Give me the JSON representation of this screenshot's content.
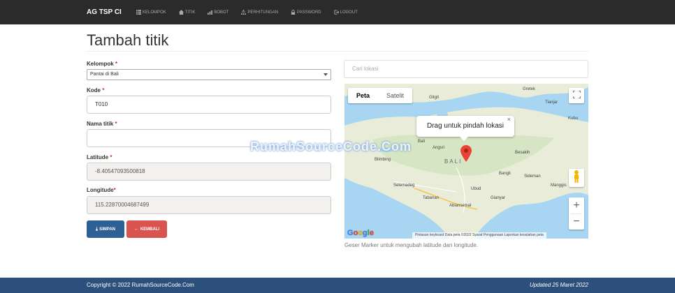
{
  "navbar": {
    "brand": "AG TSP CI",
    "items": [
      {
        "label": "KELOMPOK",
        "icon": "list-icon"
      },
      {
        "label": "TITIK",
        "icon": "home-icon"
      },
      {
        "label": "BOBOT",
        "icon": "bar-chart-icon"
      },
      {
        "label": "PERHITUNGAN",
        "icon": "sitemap-icon"
      },
      {
        "label": "PASSWORD",
        "icon": "lock-icon"
      },
      {
        "label": "LOGOUT",
        "icon": "logout-icon"
      }
    ]
  },
  "page": {
    "title": "Tambah titik"
  },
  "form": {
    "kelompok_label": "Kelompok",
    "kelompok_value": "Pantai di Bali",
    "kode_label": "Kode",
    "kode_value": "T010",
    "nama_label": "Nama titik",
    "nama_value": "",
    "lat_label": "Latitude",
    "lat_value": "-8.40547093500818",
    "lng_label": "Longitude",
    "lng_value": "115.22870004687499",
    "required_mark": "*",
    "save_label": "SIMPAN",
    "back_label": "KEMBALI"
  },
  "map": {
    "search_placeholder": "Cari lokasi",
    "type_map": "Peta",
    "type_satellite": "Satelit",
    "info_text": "Drag untuk pindah lokasi",
    "info_close": "×",
    "zoom_in": "+",
    "zoom_out": "−",
    "places": {
      "gitgit": "Gitgit",
      "gretek": "Gretek",
      "tianjar": "Tianjar",
      "kubu": "Kubu",
      "bali_small": "Bali",
      "angsri": "Angsri",
      "bali": "BALI",
      "besakih": "Besakih",
      "blimbing": "Blimbing",
      "bangli": "Bangli",
      "sideman": "Sideman",
      "selemadeg": "Selemadeg",
      "ubud": "Ubud",
      "manggis": "Manggis",
      "tabanan": "Tabanan",
      "gianyar": "Gianyar",
      "abiansemal": "Abiansemal"
    },
    "attribution": "Pintasan keyboard   Data peta ©2022   Syarat Penggunaan   Laporkan kesalahan peta",
    "help_text": "Geser Marker untuk mengubah latitude dan longitude."
  },
  "watermark": "RumahSourceCode.Com",
  "footer": {
    "copyright": "Copyright © 2022 RumahSourceCode.Com",
    "updated": "Updated 25 Maret 2022"
  },
  "colors": {
    "navbar": "#2b2b2b",
    "footer": "#2c4f7c",
    "save": "#2e6096",
    "back": "#d9534f",
    "sea": "#a7d5f2",
    "land": "#e8ecd9",
    "marker": "#ea4335"
  }
}
